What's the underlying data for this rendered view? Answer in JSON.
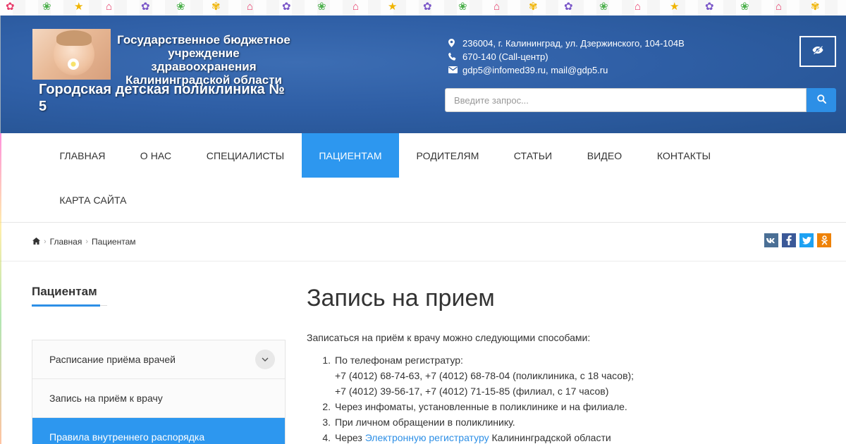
{
  "header": {
    "org_lines": [
      "Государственное бюджетное",
      "учреждение здравоохранения",
      "Калининградской области"
    ],
    "subtitle": "Городская детская поликлиника № 5",
    "address": "236004, г. Калининград, ул. Дзержинского, 104-104В",
    "phone": "670-140 (Call-центр)",
    "email": "gdp5@infomed39.ru, mail@gdp5.ru",
    "search_placeholder": "Введите запрос..."
  },
  "nav": {
    "items": [
      "ГЛАВНАЯ",
      "О НАС",
      "СПЕЦИАЛИСТЫ",
      "ПАЦИЕНТАМ",
      "РОДИТЕЛЯМ",
      "СТАТЬИ",
      "ВИДЕО",
      "КОНТАКТЫ",
      "КАРТА САЙТА"
    ],
    "active": "ПАЦИЕНТАМ"
  },
  "breadcrumb": {
    "home": "Главная",
    "current": "Пациентам"
  },
  "sidebar": {
    "title": "Пациентам",
    "items": [
      "Расписание приёма врачей",
      "Запись на приём к врачу",
      "Правила внутреннего распорядка"
    ]
  },
  "content": {
    "title": "Запись на прием",
    "intro": "Записаться на приём к врачу можно следующими способами:",
    "steps": [
      {
        "num": "1.",
        "lines": [
          "По телефонам регистратур:",
          "+7 (4012) 68-74-63, +7 (4012) 68-78-04 (поликлиника, с 18 часов);",
          "+7 (4012) 39-56-17, +7 (4012) 71-15-85 (филиал, с 17 часов)"
        ]
      },
      {
        "num": "2.",
        "lines": [
          "Через инфоматы, установленные в поликлинике и на филиале."
        ]
      },
      {
        "num": "3.",
        "lines": [
          "При личном обращении в поликлинику."
        ]
      },
      {
        "num": "4.",
        "before": "Через ",
        "link": "Электронную регистратуру",
        "after": " Калининградской области"
      }
    ]
  },
  "colors": {
    "header_blue": "#2f5fa6",
    "accent": "#2d97ef",
    "link": "#2d8fe6"
  },
  "icons": [
    "map-marker-icon",
    "phone-icon",
    "envelope-icon",
    "eye-slash-icon",
    "search-icon",
    "home-icon",
    "chevron-down-icon",
    "vk-icon",
    "facebook-icon",
    "twitter-icon",
    "odnoklassniki-icon"
  ]
}
